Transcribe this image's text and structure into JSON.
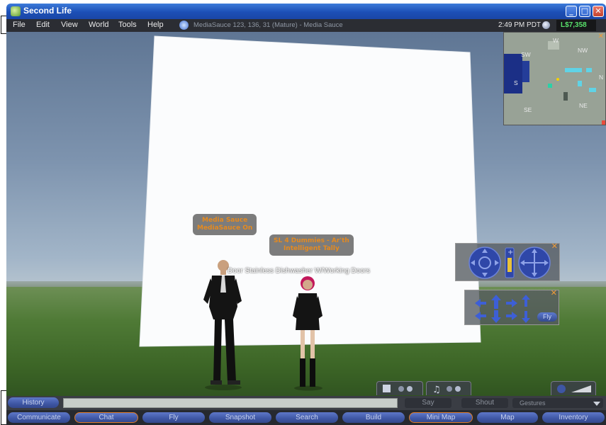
{
  "window": {
    "title": "Second Life",
    "minimize_glyph": "_",
    "maximize_glyph": "□",
    "close_glyph": "✕"
  },
  "menu": {
    "items": [
      "File",
      "Edit",
      "View",
      "World",
      "Tools",
      "Help"
    ],
    "location": "MediaSauce 123, 136, 31 (Mature) - Media Sauce",
    "time": "2:49 PM PDT",
    "balance": "L$7,358"
  },
  "scene": {
    "nametag_1": [
      "Media Sauce",
      "MediaSauce On"
    ],
    "nametag_2": [
      "SL 4 Dummies - Ar'th",
      "Intelligent Tally"
    ],
    "floating_text": "Door Stainless Dishwasher W/Working Doors"
  },
  "minimap": {
    "directions": {
      "nw_left": "SW",
      "w": "W",
      "nw": "NW",
      "s": "S",
      "n": "N",
      "se": "SE",
      "ne": "NE"
    }
  },
  "move_controls": {
    "fly_label": "Fly"
  },
  "chatbar": {
    "history_label": "History",
    "input_value": "",
    "say_label": "Say",
    "shout_label": "Shout",
    "gestures_label": "Gestures"
  },
  "toolbar": {
    "buttons": [
      "Communicate",
      "Chat",
      "Fly",
      "Snapshot",
      "Search",
      "Build",
      "Mini Map",
      "Map",
      "Inventory"
    ],
    "active": [
      "Chat",
      "Mini Map"
    ]
  },
  "colors": {
    "menu_bar": "#2b2d33",
    "balance_green": "#58e06a",
    "nametag_orange": "#e58a1f",
    "button_blue": "#3e56a4",
    "active_outline": "#e07b26"
  }
}
